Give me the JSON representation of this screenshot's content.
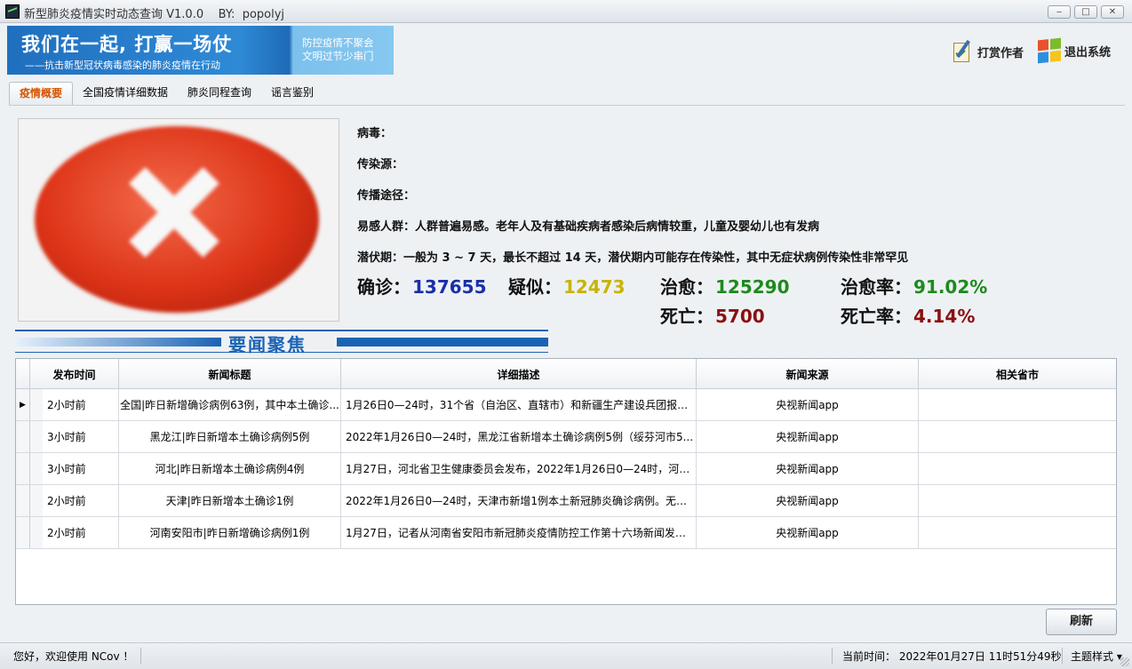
{
  "window": {
    "title": "新型肺炎疫情实时动态查询 V1.0.0    BY:  popolyj",
    "min_label": "‒",
    "max_label": "□",
    "close_label": "✕"
  },
  "banner": {
    "main": "我们在一起, 打赢一场仗",
    "sub": "——抗击新型冠状病毒感染的肺炎疫情在行动",
    "right_line1": "防控疫情不聚会",
    "right_line2": "文明过节少串门"
  },
  "actions": {
    "reward": "打赏作者",
    "exit": "退出系统"
  },
  "tabs": [
    {
      "label": "疫情概要",
      "active": true
    },
    {
      "label": "全国疫情详细数据",
      "active": false
    },
    {
      "label": "肺炎同程查询",
      "active": false
    },
    {
      "label": "谣言鉴别",
      "active": false
    }
  ],
  "info": {
    "virus": "病毒：",
    "source": "传染源：",
    "route": "传播途径：",
    "susceptible": "易感人群：人群普遍易感。老年人及有基础疾病者感染后病情较重，儿童及婴幼儿也有发病",
    "incubation": "潜伏期：一般为 3 ~ 7 天，最长不超过 14 天，潜伏期内可能存在传染性，其中无症状病例传染性非常罕见"
  },
  "stats": {
    "confirmed_label": "确诊：",
    "confirmed": "137655",
    "confirmed_color": "#1a2fa8",
    "suspected_label": "疑似：",
    "suspected": "12473",
    "suspected_color": "#c8b400",
    "cured_label": "治愈：",
    "cured": "125290",
    "cured_color": "#1e8a1e",
    "cure_rate_label": "治愈率：",
    "cure_rate": "91.02%",
    "cure_rate_color": "#1e8a1e",
    "death_label": "死亡：",
    "death": "5700",
    "death_color": "#8b1010",
    "death_rate_label": "死亡率：",
    "death_rate": "4.14%",
    "death_rate_color": "#8b1010"
  },
  "news": {
    "heading": "要闻聚焦",
    "columns": [
      "发布时间",
      "新闻标题",
      "详细描述",
      "新闻来源",
      "相关省市"
    ],
    "rows": [
      {
        "time": "2小时前",
        "title": "全国|昨日新增确诊病例63例，其中本土确诊...",
        "desc": "1月26日0—24时，31个省（自治区、直辖市）和新疆生产建设兵团报告...",
        "source": "央视新闻app",
        "province": "",
        "selected": true
      },
      {
        "time": "3小时前",
        "title": "黑龙江|昨日新增本土确诊病例5例",
        "desc": "2022年1月26日0—24时，黑龙江省新增本土确诊病例5例（绥芬河市5...",
        "source": "央视新闻app",
        "province": "",
        "selected": false
      },
      {
        "time": "3小时前",
        "title": "河北|昨日新增本土确诊病例4例",
        "desc": "1月27日，河北省卫生健康委员会发布，2022年1月26日0—24时，河北...",
        "source": "央视新闻app",
        "province": "",
        "selected": false
      },
      {
        "time": "2小时前",
        "title": "天津|昨日新增本土确诊1例",
        "desc": "2022年1月26日0—24时，天津市新增1例本土新冠肺炎确诊病例。无新...",
        "source": "央视新闻app",
        "province": "",
        "selected": false
      },
      {
        "time": "2小时前",
        "title": "河南安阳市|昨日新增确诊病例1例",
        "desc": "1月27日，记者从河南省安阳市新冠肺炎疫情防控工作第十六场新闻发布...",
        "source": "央视新闻app",
        "province": "",
        "selected": false
      }
    ]
  },
  "refresh_label": "刷新",
  "status": {
    "welcome": "您好，欢迎使用 NCov ！",
    "time": "当前时间： 2022年01月27日 11时51分49秒",
    "theme": "主题样式 ▾"
  }
}
